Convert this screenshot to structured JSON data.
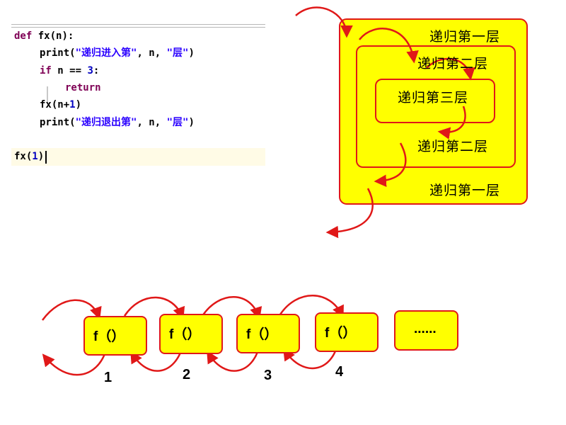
{
  "code": {
    "line1": {
      "kw": "def",
      "rest": " fx(n):"
    },
    "line2": {
      "fn": "print(",
      "str1": "\"递归进入第\"",
      "mid": ", n, ",
      "str2": "\"层\"",
      "end": ")"
    },
    "line3": {
      "kw": "if",
      "mid": " n == ",
      "num": "3",
      "end": ":"
    },
    "line4": {
      "kw": "return"
    },
    "line5": {
      "fn": "fx(n+",
      "num": "1",
      "end": ")"
    },
    "line6": {
      "fn": "print(",
      "str1": "\"递归退出第\"",
      "mid": ", n, ",
      "str2": "\"层\"",
      "end": ")"
    },
    "call": {
      "fn": "fx(",
      "num": "1",
      "end": ")"
    }
  },
  "nested": {
    "layer1_enter": "递归第一层",
    "layer2_enter": "递归第二层",
    "layer3": "递归第三层",
    "layer2_exit": "递归第二层",
    "layer1_exit": "递归第一层"
  },
  "chain": {
    "boxes": [
      "f（）",
      "f（）",
      "f（）",
      "f（）",
      "......"
    ],
    "numbers": [
      "1",
      "2",
      "3",
      "4"
    ]
  },
  "colors": {
    "fill": "#ffff00",
    "border": "#e01818",
    "arrow": "#e01818"
  }
}
